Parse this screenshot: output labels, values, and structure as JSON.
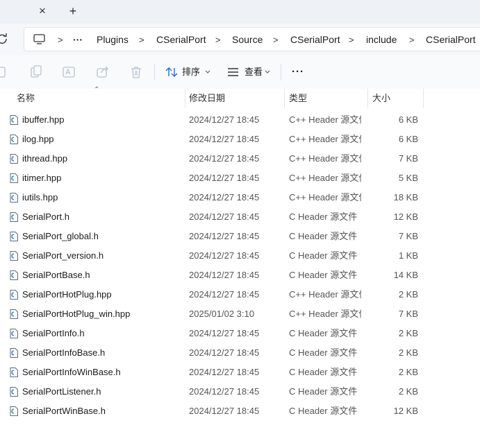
{
  "tabstrip": {
    "close_glyph": "×",
    "new_tab_glyph": "+"
  },
  "address": {
    "overflow": "···",
    "separator": ">",
    "crumbs": [
      "Plugins",
      "CSerialPort",
      "Source",
      "CSerialPort",
      "include",
      "CSerialPort"
    ]
  },
  "toolbar": {
    "sort_label": "排序",
    "view_label": "查看",
    "more_glyph": "···"
  },
  "columns": {
    "name": "名称",
    "date": "修改日期",
    "type": "类型",
    "size": "大小"
  },
  "files": [
    {
      "name": "ibuffer.hpp",
      "date": "2024/12/27 18:45",
      "type": "C++ Header 源文件",
      "size": "6 KB",
      "icon": "cpp-header-file-icon"
    },
    {
      "name": "ilog.hpp",
      "date": "2024/12/27 18:45",
      "type": "C++ Header 源文件",
      "size": "6 KB",
      "icon": "cpp-header-file-icon"
    },
    {
      "name": "ithread.hpp",
      "date": "2024/12/27 18:45",
      "type": "C++ Header 源文件",
      "size": "7 KB",
      "icon": "cpp-header-file-icon"
    },
    {
      "name": "itimer.hpp",
      "date": "2024/12/27 18:45",
      "type": "C++ Header 源文件",
      "size": "5 KB",
      "icon": "cpp-header-file-icon"
    },
    {
      "name": "iutils.hpp",
      "date": "2024/12/27 18:45",
      "type": "C++ Header 源文件",
      "size": "18 KB",
      "icon": "cpp-header-file-icon"
    },
    {
      "name": "SerialPort.h",
      "date": "2024/12/27 18:45",
      "type": "C Header 源文件",
      "size": "12 KB",
      "icon": "c-header-file-icon"
    },
    {
      "name": "SerialPort_global.h",
      "date": "2024/12/27 18:45",
      "type": "C Header 源文件",
      "size": "7 KB",
      "icon": "c-header-file-icon"
    },
    {
      "name": "SerialPort_version.h",
      "date": "2024/12/27 18:45",
      "type": "C Header 源文件",
      "size": "1 KB",
      "icon": "c-header-file-icon"
    },
    {
      "name": "SerialPortBase.h",
      "date": "2024/12/27 18:45",
      "type": "C Header 源文件",
      "size": "14 KB",
      "icon": "c-header-file-icon"
    },
    {
      "name": "SerialPortHotPlug.hpp",
      "date": "2024/12/27 18:45",
      "type": "C++ Header 源文件",
      "size": "2 KB",
      "icon": "cpp-header-file-icon"
    },
    {
      "name": "SerialPortHotPlug_win.hpp",
      "date": "2025/01/02 3:10",
      "type": "C++ Header 源文件",
      "size": "7 KB",
      "icon": "cpp-header-file-icon"
    },
    {
      "name": "SerialPortInfo.h",
      "date": "2024/12/27 18:45",
      "type": "C Header 源文件",
      "size": "2 KB",
      "icon": "c-header-file-icon"
    },
    {
      "name": "SerialPortInfoBase.h",
      "date": "2024/12/27 18:45",
      "type": "C Header 源文件",
      "size": "2 KB",
      "icon": "c-header-file-icon"
    },
    {
      "name": "SerialPortInfoWinBase.h",
      "date": "2024/12/27 18:45",
      "type": "C Header 源文件",
      "size": "2 KB",
      "icon": "c-header-file-icon"
    },
    {
      "name": "SerialPortListener.h",
      "date": "2024/12/27 18:45",
      "type": "C Header 源文件",
      "size": "2 KB",
      "icon": "c-header-file-icon"
    },
    {
      "name": "SerialPortWinBase.h",
      "date": "2024/12/27 18:45",
      "type": "C Header 源文件",
      "size": "12 KB",
      "icon": "c-header-file-icon"
    }
  ],
  "colors": {
    "accent": "#2a6cc7",
    "disabled_icon": "#b7c2d0"
  }
}
